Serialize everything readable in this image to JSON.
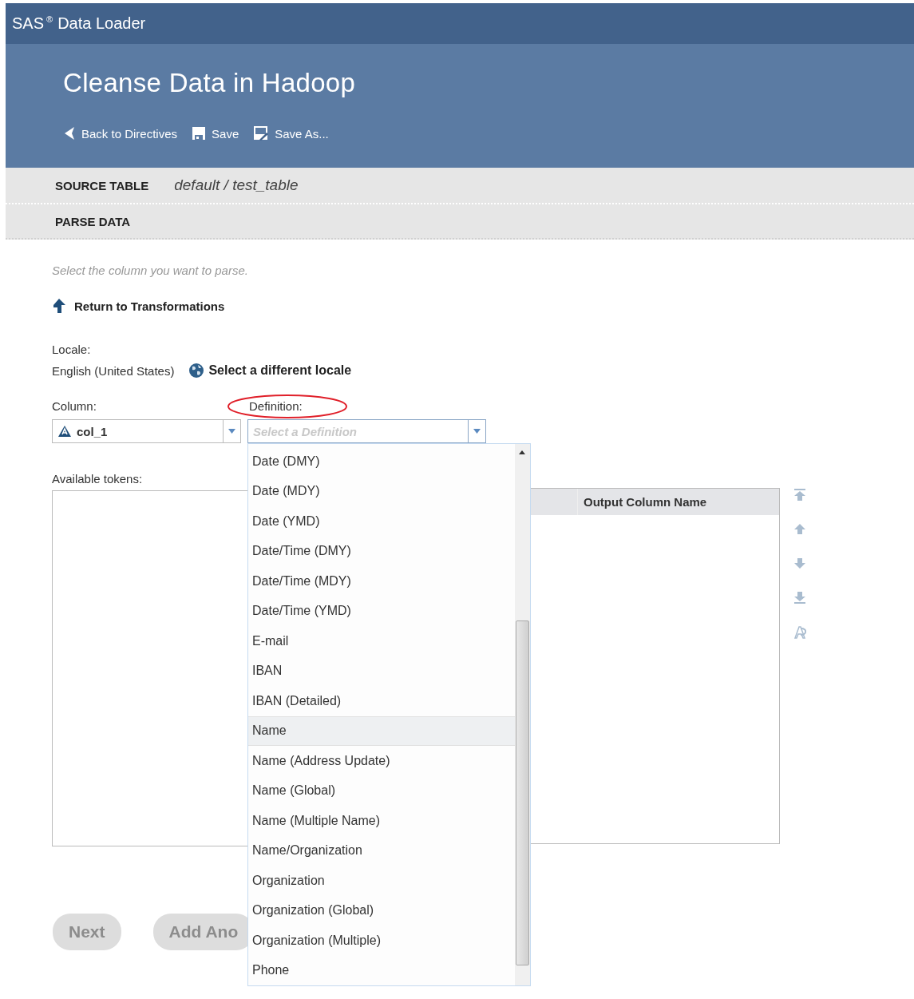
{
  "app": {
    "brand": "SAS",
    "brand_mark": "®",
    "product": "Data Loader"
  },
  "page": {
    "title": "Cleanse Data in Hadoop"
  },
  "toolbar": [
    {
      "kind": "back",
      "label": "Back to Directives"
    },
    {
      "kind": "save",
      "label": "Save"
    },
    {
      "kind": "saveas",
      "label": "Save As..."
    }
  ],
  "source_table": {
    "label": "SOURCE TABLE",
    "schema": "default",
    "separator": "/",
    "table": "test_table"
  },
  "section": {
    "label": "PARSE DATA"
  },
  "instruction": "Select the column you want to parse.",
  "return_link": "Return to Transformations",
  "locale": {
    "label": "Locale:",
    "value": "English (United States)",
    "link": "Select a different locale"
  },
  "column": {
    "label": "Column:",
    "value": "col_1"
  },
  "definition": {
    "label": "Definition:",
    "placeholder": "Select a Definition",
    "highlighted": true,
    "options": [
      {
        "label": "Date (DMY)",
        "selected": false
      },
      {
        "label": "Date (MDY)",
        "selected": false
      },
      {
        "label": "Date (YMD)",
        "selected": false
      },
      {
        "label": "Date/Time (DMY)",
        "selected": false
      },
      {
        "label": "Date/Time (MDY)",
        "selected": false
      },
      {
        "label": "Date/Time (YMD)",
        "selected": false
      },
      {
        "label": "E-mail",
        "selected": false
      },
      {
        "label": "IBAN",
        "selected": false
      },
      {
        "label": "IBAN (Detailed)",
        "selected": false
      },
      {
        "label": "Name",
        "selected": true
      },
      {
        "label": "Name (Address Update)",
        "selected": false
      },
      {
        "label": "Name (Global)",
        "selected": false
      },
      {
        "label": "Name (Multiple Name)",
        "selected": false
      },
      {
        "label": "Name/Organization",
        "selected": false
      },
      {
        "label": "Organization",
        "selected": false
      },
      {
        "label": "Organization (Global)",
        "selected": false
      },
      {
        "label": "Organization (Multiple)",
        "selected": false
      },
      {
        "label": "Phone",
        "selected": false
      }
    ]
  },
  "tokens": {
    "label": "Available tokens:"
  },
  "output_table": {
    "columns": [
      "Output Column Name"
    ]
  },
  "side_tools": [
    {
      "kind": "top",
      "disabled": true
    },
    {
      "kind": "up",
      "disabled": true
    },
    {
      "kind": "down",
      "disabled": true
    },
    {
      "kind": "bottom",
      "disabled": true
    },
    {
      "kind": "rename",
      "disabled": true
    }
  ],
  "buttons": [
    {
      "label": "Next",
      "disabled": true
    },
    {
      "label": "Add Ano",
      "disabled": true
    }
  ]
}
